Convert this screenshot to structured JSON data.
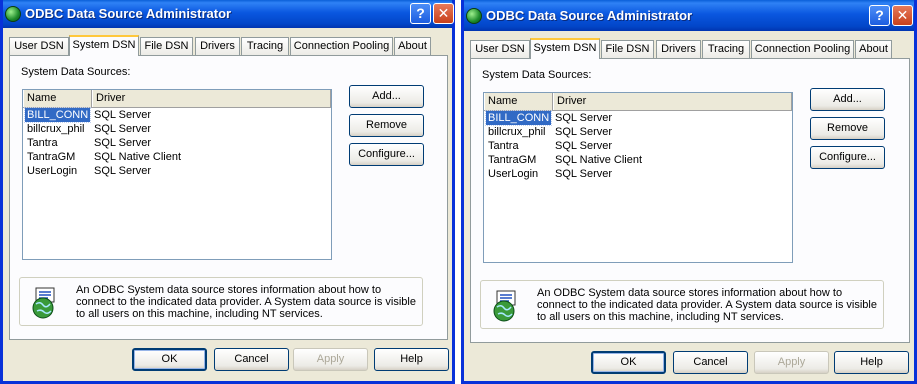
{
  "windows": [
    {
      "title": "ODBC Data Source Administrator",
      "help_glyph": "?",
      "close_glyph": "✕",
      "tabs": [
        {
          "label": "User DSN"
        },
        {
          "label": "System DSN"
        },
        {
          "label": "File DSN"
        },
        {
          "label": "Drivers"
        },
        {
          "label": "Tracing"
        },
        {
          "label": "Connection Pooling"
        },
        {
          "label": "About"
        }
      ],
      "active_tab": "System DSN",
      "section_label": "System Data Sources:",
      "columns": {
        "name": "Name",
        "driver": "Driver"
      },
      "rows": [
        {
          "name": "BILL_CONN",
          "driver": "SQL Server"
        },
        {
          "name": "billcrux_phil",
          "driver": "SQL Server"
        },
        {
          "name": "Tantra",
          "driver": "SQL Server"
        },
        {
          "name": "TantraGM",
          "driver": "SQL Native Client"
        },
        {
          "name": "UserLogin",
          "driver": "SQL Server"
        }
      ],
      "selected_row": "BILL_CONN",
      "buttons": {
        "add": "Add...",
        "remove": "Remove",
        "configure": "Configure..."
      },
      "info_text": "An ODBC System data source stores information about how to connect to the indicated data provider.   A System data source is visible to all users on this machine, including NT services.",
      "bottom": {
        "ok": "OK",
        "cancel": "Cancel",
        "apply": "Apply",
        "help": "Help"
      }
    },
    {
      "title": "ODBC Data Source Administrator",
      "help_glyph": "?",
      "close_glyph": "✕",
      "tabs": [
        {
          "label": "User DSN"
        },
        {
          "label": "System DSN"
        },
        {
          "label": "File DSN"
        },
        {
          "label": "Drivers"
        },
        {
          "label": "Tracing"
        },
        {
          "label": "Connection Pooling"
        },
        {
          "label": "About"
        }
      ],
      "active_tab": "System DSN",
      "section_label": "System Data Sources:",
      "columns": {
        "name": "Name",
        "driver": "Driver"
      },
      "rows": [
        {
          "name": "BILL_CONN",
          "driver": "SQL Server"
        },
        {
          "name": "billcrux_phil",
          "driver": "SQL Server"
        },
        {
          "name": "Tantra",
          "driver": "SQL Server"
        },
        {
          "name": "TantraGM",
          "driver": "SQL Native Client"
        },
        {
          "name": "UserLogin",
          "driver": "SQL Server"
        }
      ],
      "selected_row": "BILL_CONN",
      "buttons": {
        "add": "Add...",
        "remove": "Remove",
        "configure": "Configure..."
      },
      "info_text": "An ODBC System data source stores information about how to connect to the indicated data provider.   A System data source is visible to all users on this machine, including NT services.",
      "bottom": {
        "ok": "OK",
        "cancel": "Cancel",
        "apply": "Apply",
        "help": "Help"
      }
    }
  ],
  "colors": {
    "titlebar": "#0a57e0",
    "selection": "#316ac5",
    "active_tab_highlight": "#ffc83c",
    "dialog_face": "#ece9d8"
  },
  "icons": [
    "odbc-globe-icon",
    "help-icon",
    "close-icon",
    "data-source-info-icon"
  ]
}
